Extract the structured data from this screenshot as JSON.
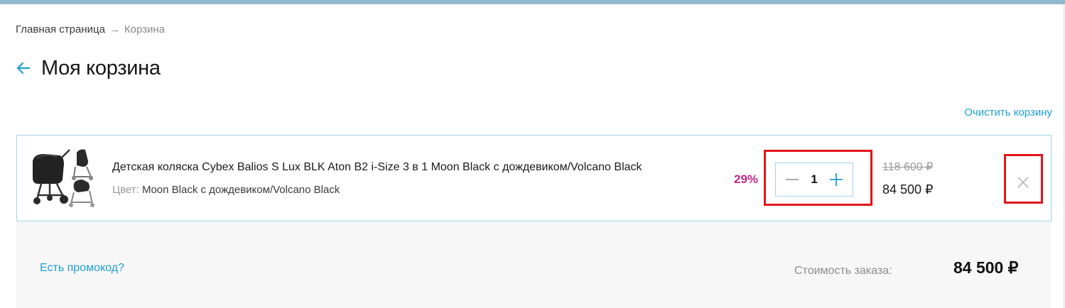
{
  "breadcrumb": {
    "home": "Главная страница",
    "separator": "→",
    "current": "Корзина"
  },
  "page": {
    "title": "Моя корзина"
  },
  "actions": {
    "clear_cart": "Очистить корзину"
  },
  "cart": {
    "items": [
      {
        "name": "Детская коляска Cybex Balios S Lux BLK Aton B2 i-Size 3 в 1 Moon Black с дождевиком/Volcano Black",
        "color_label": "Цвет:",
        "color_value": "Moon Black с дождевиком/Volcano Black",
        "discount": "29%",
        "quantity": "1",
        "old_price": "118 600 ₽",
        "price": "84 500 ₽"
      }
    ]
  },
  "summary": {
    "promo_link": "Есть промокод?",
    "order_label": "Стоимость заказа:",
    "order_total": "84 500 ₽"
  },
  "colors": {
    "accent": "#1e9fd0",
    "discount": "#c0288a",
    "highlight": "#e3151b",
    "border": "#9fd3e8",
    "top_strip": "#8fb8cc"
  },
  "icons": {
    "back": "arrow-left-icon",
    "minus": "minus-icon",
    "plus": "plus-icon",
    "remove": "close-icon"
  }
}
